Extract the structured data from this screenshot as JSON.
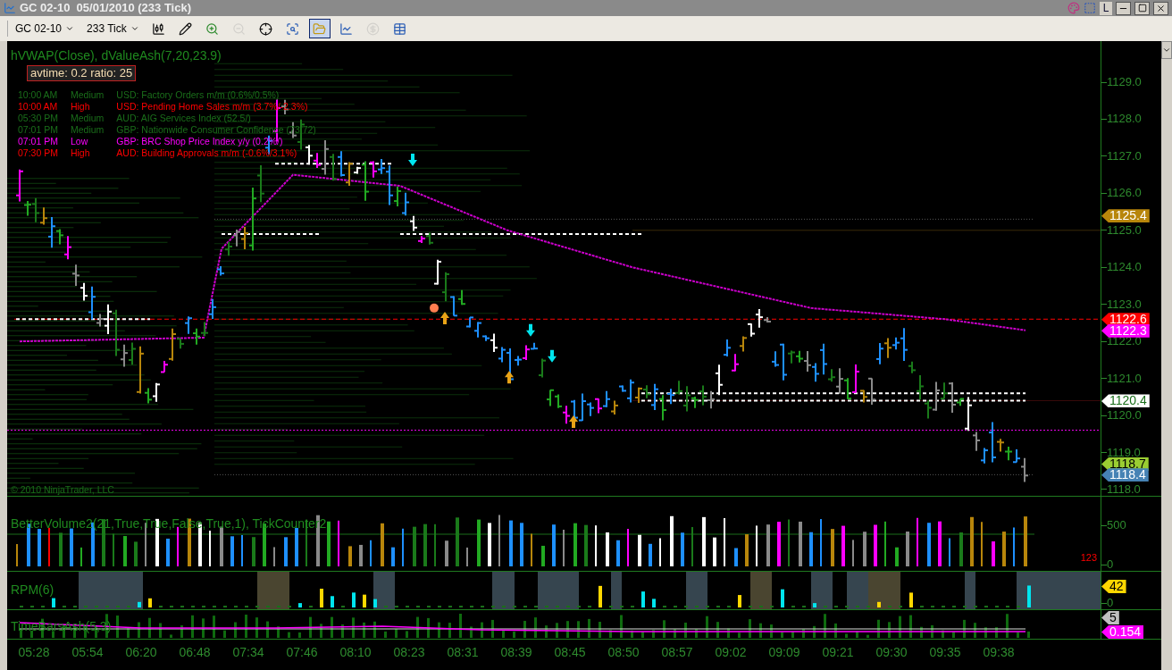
{
  "window": {
    "title": "GC 02-10  05/01/2010 (233 Tick)",
    "tag": "L"
  },
  "toolbar": {
    "instrument": "GC 02-10",
    "period": "233 Tick",
    "buttons": [
      {
        "kind": "bar-style",
        "selected": false,
        "disabled": false
      },
      {
        "kind": "pencil",
        "selected": false,
        "disabled": false
      },
      {
        "kind": "zoom-in",
        "selected": false,
        "disabled": false
      },
      {
        "kind": "zoom-out",
        "selected": false,
        "disabled": true
      },
      {
        "kind": "crosshair",
        "selected": false,
        "disabled": false
      },
      {
        "kind": "zoom-box",
        "selected": false,
        "disabled": false
      },
      {
        "kind": "data-series",
        "selected": true,
        "disabled": false
      },
      {
        "kind": "indicators",
        "selected": false,
        "disabled": false
      },
      {
        "kind": "dollar",
        "selected": false,
        "disabled": true
      },
      {
        "kind": "properties",
        "selected": false,
        "disabled": false
      }
    ]
  },
  "price_panel": {
    "indicator_label": "hVWAP(Close), dValueAsh(7,20,23.9)",
    "stats_box": "avtime: 0.2 ratio: 25",
    "news": [
      {
        "time": "10:00 AM",
        "impact": "Medium",
        "event": "USD: Factory Orders m/m (0.6%/0.5%)",
        "color": "#1a6e1a"
      },
      {
        "time": "10:00 AM",
        "impact": "High",
        "event": "USD: Pending Home Sales m/m (3.7%/-2.3%)",
        "color": "#ff0000"
      },
      {
        "time": "05:30 PM",
        "impact": "Medium",
        "event": "AUD: AIG Services Index (52.5/)",
        "color": "#1a6e1a"
      },
      {
        "time": "07:01 PM",
        "impact": "Medium",
        "event": "GBP: Nationwide Consumer Confidence (73/72)",
        "color": "#1a6e1a"
      },
      {
        "time": "07:01 PM",
        "impact": "Low",
        "event": "GBP: BRC Shop Price Index y/y (0.2%/)",
        "color": "#ff00ff"
      },
      {
        "time": "07:30 PM",
        "impact": "High",
        "event": "AUD: Building Approvals m/m (-0.6%/3.1%)",
        "color": "#ff0000"
      }
    ],
    "copyright": "© 2010 NinjaTrader, LLC",
    "axis_ticks": [
      "1129.0",
      "1128.0",
      "1127.0",
      "1126.0",
      "1125.0",
      "1124.0",
      "1123.0",
      "1122.0",
      "1121.0",
      "1120.0",
      "1119.0",
      "1118.0"
    ],
    "price_markers": [
      {
        "value": "1125.4",
        "color": "#b8860b"
      },
      {
        "value": "1122.6",
        "color": "#ff0000"
      },
      {
        "value": "1122.3",
        "color": "#ff00ff"
      },
      {
        "value": "1120.4",
        "color": "#ffffff"
      },
      {
        "value": "1118.7",
        "color": "#9acd32"
      },
      {
        "value": "1118.4",
        "color": "#4682b4"
      }
    ]
  },
  "volume_panel": {
    "label": "BetterVolume2(21,True,True,False,True,1), TickCounter2",
    "counter": "123",
    "axis_ticks": [
      "500",
      "0"
    ]
  },
  "rpm_panel": {
    "label": "RPM(6)",
    "axis_ticks": [
      "0"
    ],
    "marker": {
      "value": "42",
      "color": "#ffd700"
    }
  },
  "timebars_panel": {
    "label": "TimeBarsAsh(5,3)",
    "markers": [
      {
        "value": "5",
        "color": "#c0c0c0"
      },
      {
        "value": "0.154",
        "color": "#ff00ff"
      }
    ]
  },
  "time_axis": [
    "05:28",
    "05:54",
    "06:20",
    "06:48",
    "07:34",
    "07:46",
    "08:10",
    "08:23",
    "08:31",
    "08:39",
    "08:45",
    "08:50",
    "08:57",
    "09:02",
    "09:09",
    "09:21",
    "09:30",
    "09:35",
    "09:38"
  ]
}
